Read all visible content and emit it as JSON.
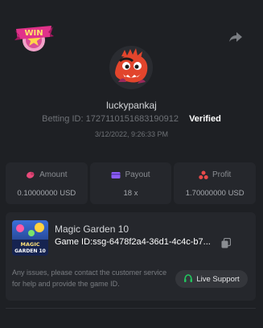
{
  "header": {
    "win_badge_text": "WIN",
    "username": "luckypankaj",
    "betting_id_label": "Betting ID:",
    "betting_id": "1727110151683190912",
    "verified": "Verified",
    "timestamp": "3/12/2022, 9:26:33 PM"
  },
  "stats": [
    {
      "label": "Amount",
      "value": "0.10000000 USD",
      "icon": "amount-icon"
    },
    {
      "label": "Payout",
      "value": "18 x",
      "icon": "payout-card-icon"
    },
    {
      "label": "Profit",
      "value": "1.70000000 USD",
      "icon": "profit-icon"
    }
  ],
  "game": {
    "name": "Magic Garden 10",
    "id_label": "Game ID:",
    "id_value": "ssg-6478f2a4-36d1-4c4c-b7...",
    "thumb_text_1": "MAGIC",
    "thumb_text_2": "GARDEN 10",
    "help_text": "Any issues, please contact the customer service for help and provide the game ID.",
    "support_label": "Live Support"
  },
  "colors": {
    "background": "#1e2024",
    "card": "#25272c",
    "accent_pink": "#e84a7a",
    "payout_purple": "#8b5cf6",
    "support_green": "#22c55e"
  }
}
